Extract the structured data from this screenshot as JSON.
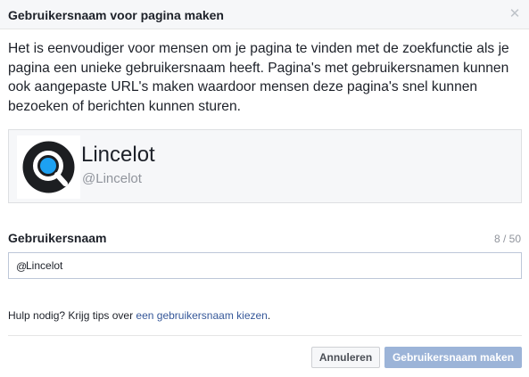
{
  "dialog": {
    "title": "Gebruikersnaam voor pagina maken",
    "close_icon": "close-icon",
    "intro_text": "Het is eenvoudiger voor mensen om je pagina te vinden met de zoekfunctie als je pagina een unieke gebruikersnaam heeft. Pagina's met gebruikersnamen kunnen ook aangepaste URL's maken waardoor mensen deze pagina's snel kunnen bezoeken of berichten kunnen sturen."
  },
  "preview": {
    "page_name": "Lincelot",
    "page_handle": "@Lincelot",
    "avatar_icon": "magnifier-logo-icon"
  },
  "username_field": {
    "label": "Gebruikersnaam",
    "counter": "8 / 50",
    "prefix": "@",
    "value": "Lincelot"
  },
  "help": {
    "text": "Hulp nodig? Krijg tips over ",
    "link": "een gebruikersnaam kiezen",
    "suffix": "."
  },
  "buttons": {
    "cancel_label": "Annuleren",
    "create_label": "Gebruikersnaam maken"
  },
  "colors": {
    "link": "#365899",
    "primary_disabled": "#9cb4d8",
    "avatar_dark": "#1c1e21",
    "avatar_accent": "#1da1f2"
  }
}
